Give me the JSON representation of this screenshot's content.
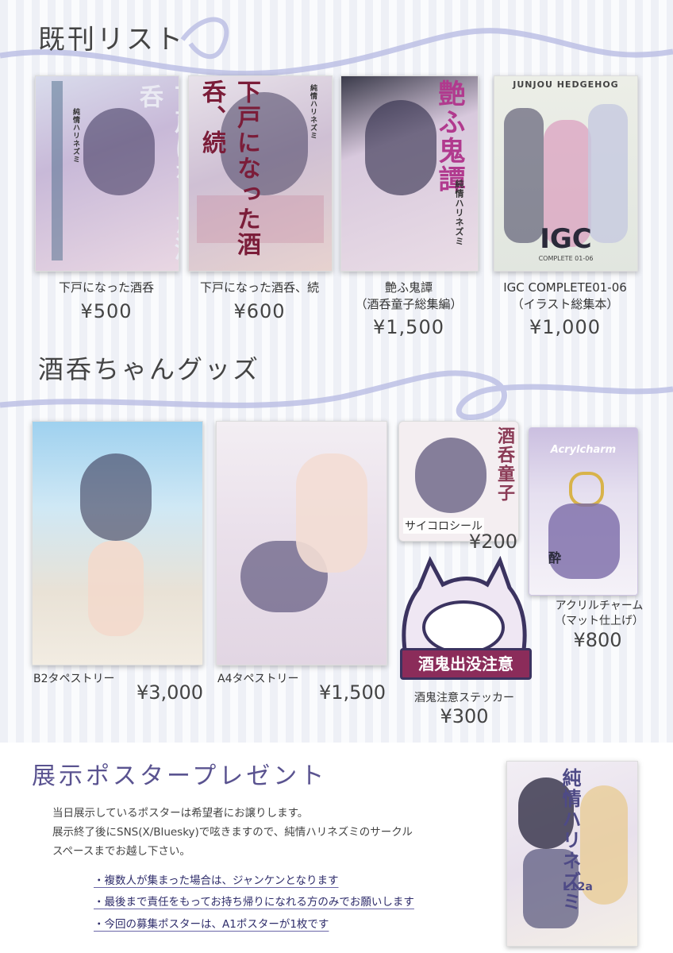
{
  "sections": {
    "books_title": "既刊リスト",
    "goods_title": "酒呑ちゃんグッズ"
  },
  "books": [
    {
      "title": "下戸になった酒呑",
      "subtitle": "",
      "price": "¥500",
      "cover_text": "下戸になった酒呑",
      "author": "純情ハリネズミ"
    },
    {
      "title": "下戸になった酒呑、続",
      "subtitle": "",
      "price": "¥600",
      "cover_text": "下戸になった酒呑、続",
      "author": "純情ハリネズミ"
    },
    {
      "title": "艶ふ鬼譚",
      "subtitle": "（酒呑童子総集編）",
      "price": "¥1,500",
      "cover_text": "艶ふ鬼譚",
      "author": "純情ハリネズミ"
    },
    {
      "title": "IGC COMPLETE01-06",
      "subtitle": "（イラスト総集本）",
      "price": "¥1,000",
      "cover_text": "JUNJOU HEDGEHOG",
      "author": "IGC"
    }
  ],
  "igc_sub": "COMPLETE 01-06",
  "goods": [
    {
      "label": "B2タペストリー",
      "price": "¥3,000"
    },
    {
      "label": "A4タペストリー",
      "price": "¥1,500"
    },
    {
      "label": "サイコロシール",
      "price": "¥200",
      "art_text": "酒呑童子"
    },
    {
      "label": "アクリルチャーム",
      "label2": "（マット仕上げ）",
      "price": "¥800",
      "art_text": "Acrylcharm",
      "art_glyph": "酔"
    },
    {
      "label": "酒鬼注意ステッカー",
      "price": "¥300",
      "art_text": "酒鬼出没注意"
    }
  ],
  "poster": {
    "title": "展示ポスタープレゼント",
    "desc": [
      "当日展示しているポスターは希望者にお譲りします。",
      "展示終了後にSNS(X/Bluesky)で呟きますので、純情ハリネズミのサークル",
      "スペースまでお越し下さい。"
    ],
    "bullets": [
      "・複数人が集まった場合は、ジャンケンとなります",
      "・最後まで責任をもってお持ち帰りになれる方のみでお願いします",
      "・今回の募集ポスターは、A1ポスターが1枚です"
    ],
    "art_text": "純情ハリネズミ",
    "art_code": "L12a"
  },
  "colors": {
    "accent": "#5a5390",
    "ribbon": "#b9bde3",
    "bullet_text": "#2f2d6b"
  }
}
